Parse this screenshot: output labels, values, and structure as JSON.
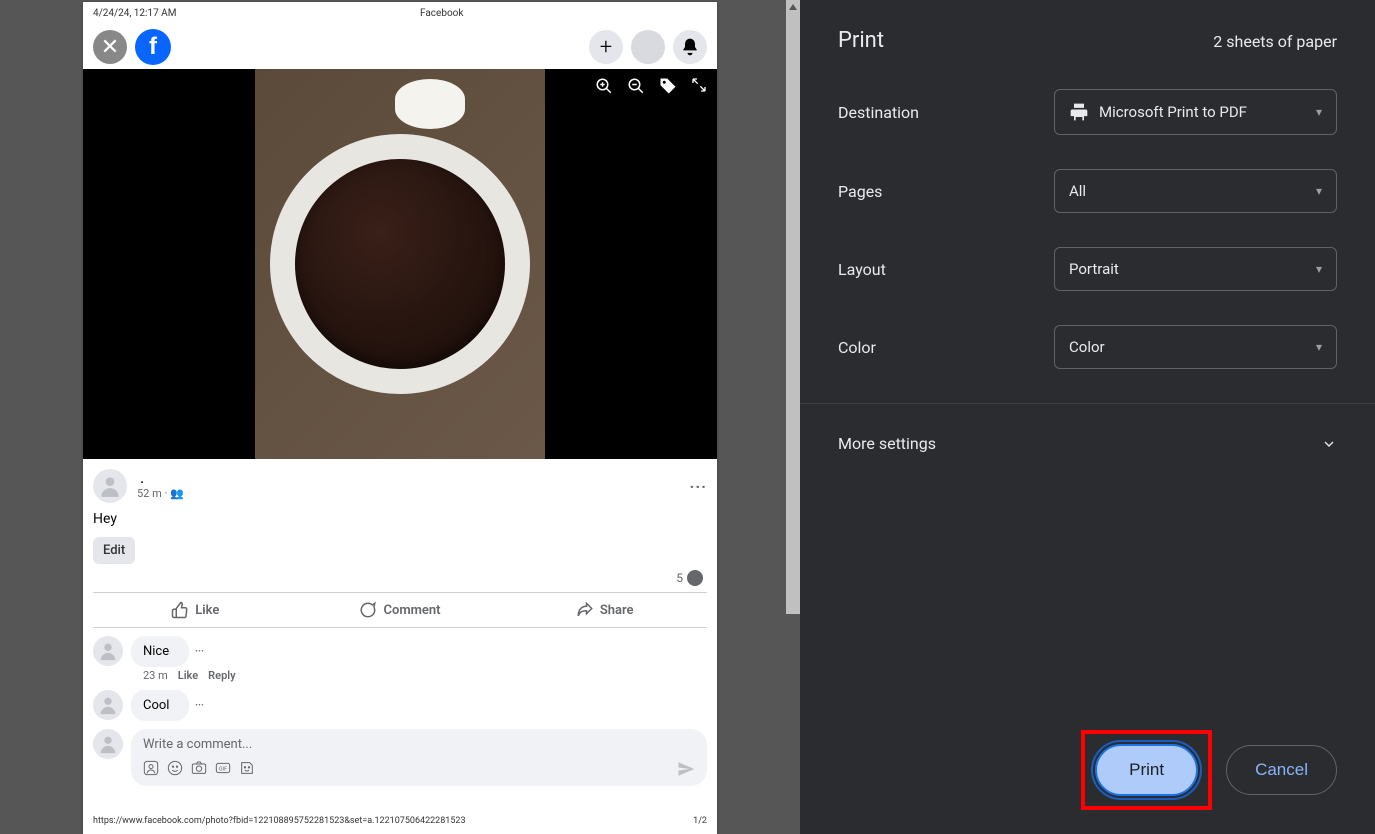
{
  "preview": {
    "header_left": "4/24/24, 12:17 AM",
    "header_center": "Facebook",
    "post": {
      "time": "52 m",
      "text": "Hey",
      "edit_label": "Edit",
      "reaction_count": "5",
      "like_label": "Like",
      "comment_label": "Comment",
      "share_label": "Share",
      "add_comment_placeholder": "Write a comment..."
    },
    "comments": [
      {
        "text": "Nice",
        "age": "23 m",
        "like": "Like",
        "reply": "Reply"
      },
      {
        "text": "Cool"
      }
    ],
    "footer_url": "https://www.facebook.com/photo?fbid=122108895752281523&set=a.122107506422281523",
    "footer_page": "1/2"
  },
  "print": {
    "title": "Print",
    "sheets": "2 sheets of paper",
    "destination_label": "Destination",
    "destination_value": "Microsoft Print to PDF",
    "pages_label": "Pages",
    "pages_value": "All",
    "layout_label": "Layout",
    "layout_value": "Portrait",
    "color_label": "Color",
    "color_value": "Color",
    "more_settings": "More settings",
    "print_btn": "Print",
    "cancel_btn": "Cancel"
  }
}
